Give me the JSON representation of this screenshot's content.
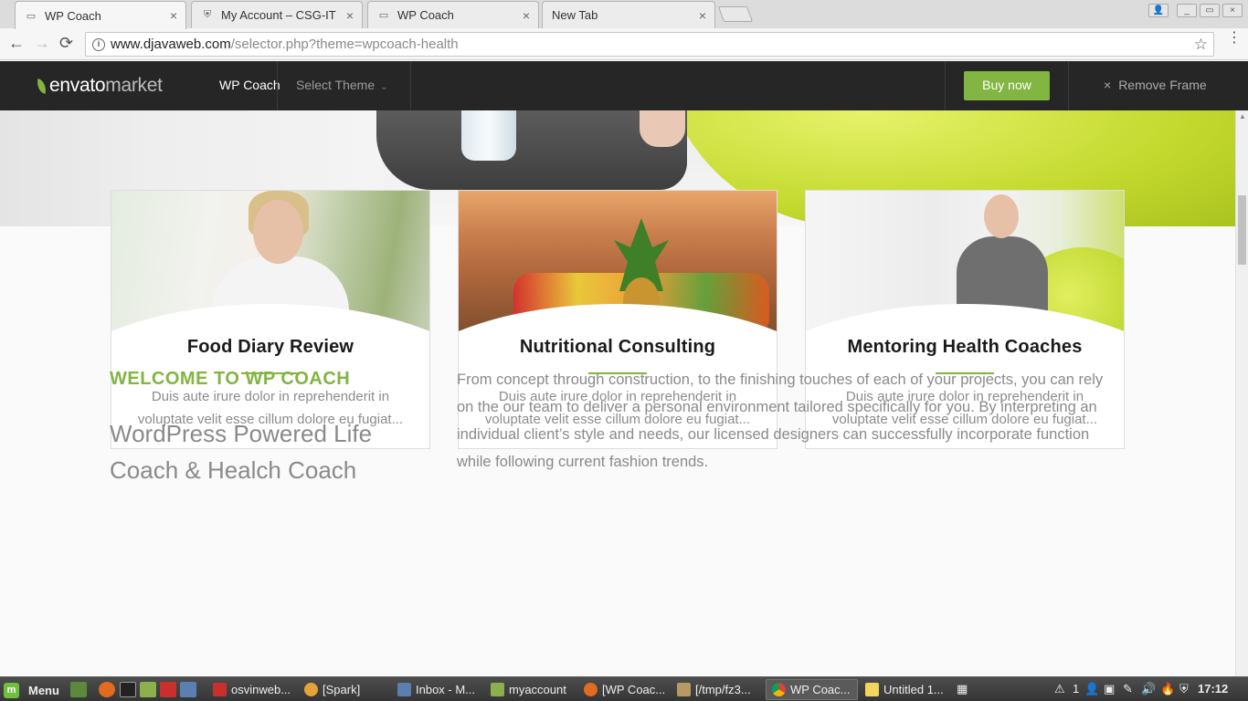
{
  "browser": {
    "tabs": [
      {
        "label": "WP Coach",
        "icon": "page-icon",
        "active": true
      },
      {
        "label": "My Account – CSG-IT",
        "icon": "shield-icon",
        "active": false
      },
      {
        "label": "WP Coach",
        "icon": "page-icon",
        "active": false
      },
      {
        "label": "New Tab",
        "icon": "",
        "active": false
      }
    ],
    "close_glyph": "×",
    "url_host": "www.djavaweb.com",
    "url_path": "/selector.php?theme=wpcoach-health",
    "icons": {
      "back": "←",
      "forward": "→",
      "reload": "⟳",
      "info": "i",
      "star": "☆",
      "menu": "⋮"
    }
  },
  "envato": {
    "logo_word1": "envato",
    "logo_word2": "market",
    "title": "WP Coach",
    "select_theme": "Select Theme",
    "chevron": "⌄",
    "buy_label": "Buy now",
    "remove_label": "Remove Frame",
    "remove_icon": "×",
    "brand_color": "#82b541"
  },
  "services": [
    {
      "title": "Food Diary Review",
      "text": "Duis aute irure dolor in reprehenderit in voluptate velit esse cillum dolore eu fugiat..."
    },
    {
      "title": "Nutritional Consulting",
      "text": "Duis aute irure dolor in reprehenderit in voluptate velit esse cillum dolore eu fugiat..."
    },
    {
      "title": "Mentoring Health Coaches",
      "text": "Duis aute irure dolor in reprehenderit in voluptate velit esse cillum dolore eu fugiat..."
    }
  ],
  "welcome": {
    "tag": "WELCOME TO WP COACH",
    "heading": "WordPress Powered Life Coach & Healch Coach",
    "body": "From concept through construction, to the finishing touches of each of your projects, you can rely on the our team to deliver a personal environment tailored specifically for you. By interpreting an individual client’s style and needs, our licensed designers can successfully incorporate function while following current fashion trends."
  },
  "taskbar": {
    "menu_label": "Menu",
    "tasks": [
      {
        "label": "osvinweb...",
        "icon": "filezilla-icon"
      },
      {
        "label": "[Spark]",
        "icon": "spark-icon"
      },
      {
        "label": "Inbox - M...",
        "icon": "thunderbird-icon"
      },
      {
        "label": "myaccount",
        "icon": "folder-icon"
      },
      {
        "label": "[WP Coac...",
        "icon": "firefox-icon"
      },
      {
        "label": "[/tmp/fz3...",
        "icon": "editor-icon"
      },
      {
        "label": "WP Coac...",
        "icon": "chrome-icon"
      },
      {
        "label": "Untitled 1...",
        "icon": "document-icon"
      }
    ],
    "tray_count": "1",
    "clock": "17:12"
  }
}
